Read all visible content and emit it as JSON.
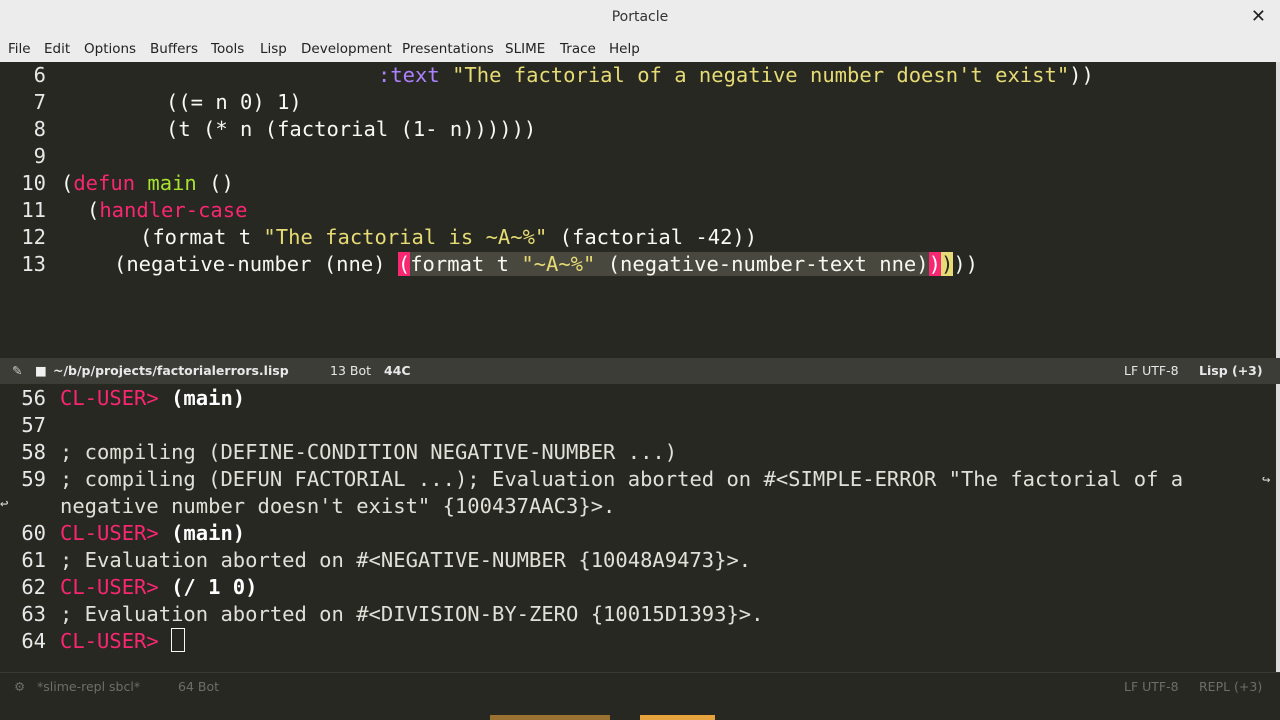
{
  "window": {
    "title": "Portacle"
  },
  "menu": [
    "File",
    "Edit",
    "Options",
    "Buffers",
    "Tools",
    "Lisp",
    "Development",
    "Presentations",
    "SLIME",
    "Trace",
    "Help"
  ],
  "editor": {
    "lines": [
      {
        "num": "6",
        "parts": [
          {
            "t": ":text",
            "c": "kwd"
          },
          {
            "t": " ",
            "c": ""
          },
          {
            "t": "\"The factorial of a negative number doesn't exist\"",
            "c": "str"
          },
          {
            "t": "))",
            "c": ""
          }
        ]
      },
      {
        "num": "7",
        "parts": [
          {
            "t": "((= n 0) 1)",
            "c": ""
          }
        ]
      },
      {
        "num": "8",
        "parts": [
          {
            "t": "(t (* n (factorial (1- n))))))",
            "c": ""
          }
        ]
      },
      {
        "num": "9",
        "parts": []
      },
      {
        "num": "10",
        "parts": [
          {
            "t": "(",
            "c": ""
          },
          {
            "t": "defun",
            "c": "kw"
          },
          {
            "t": " ",
            "c": ""
          },
          {
            "t": "main",
            "c": "fn"
          },
          {
            "t": " ()",
            "c": ""
          }
        ]
      },
      {
        "num": "11",
        "parts": [
          {
            "t": "(",
            "c": ""
          },
          {
            "t": "handler-case",
            "c": "kw"
          }
        ]
      },
      {
        "num": "12",
        "parts": [
          {
            "t": "(format t ",
            "c": ""
          },
          {
            "t": "\"The factorial is ~A~%\"",
            "c": "str"
          },
          {
            "t": " (factorial -42))",
            "c": ""
          }
        ]
      },
      {
        "num": "13",
        "parts": [
          {
            "t": "(negative-number (nne) ",
            "c": ""
          },
          {
            "t": "(",
            "c": "parenhl"
          },
          {
            "t": "format t ",
            "c": "region"
          },
          {
            "t": "\"~A~%\"",
            "c": "region str"
          },
          {
            "t": " (negative-number-text nne)",
            "c": "region"
          },
          {
            "t": ")",
            "c": "parenhl"
          },
          {
            "t": ")",
            "c": "parenmatch"
          },
          {
            "t": "))",
            "c": ""
          }
        ]
      }
    ]
  },
  "modeline": {
    "path": "~/b/p/projects/factorialerrors.lisp",
    "position": "13 Bot",
    "column": "44C",
    "encoding": "LF UTF-8",
    "mode": "Lisp (+3)"
  },
  "repl": {
    "lines": [
      {
        "num": "56",
        "prompt": "CL-USER>",
        "cmd": "(main)"
      },
      {
        "num": "57"
      },
      {
        "num": "58",
        "text": "; compiling (DEFINE-CONDITION NEGATIVE-NUMBER ...)"
      },
      {
        "num": "59",
        "text": "; compiling (DEFUN FACTORIAL ...); Evaluation aborted on #<SIMPLE-ERROR \"The factorial of a"
      },
      {
        "num": "",
        "text": "negative number doesn't exist\" {100437AAC3}>."
      },
      {
        "num": "60",
        "prompt": "CL-USER>",
        "cmd": "(main)"
      },
      {
        "num": "61",
        "text": "; Evaluation aborted on #<NEGATIVE-NUMBER {10048A9473}>."
      },
      {
        "num": "62",
        "prompt": "CL-USER>",
        "cmd": "(/ 1 0)"
      },
      {
        "num": "63",
        "text": "; Evaluation aborted on #<DIVISION-BY-ZERO {10015D1393}>."
      },
      {
        "num": "64",
        "prompt": "CL-USER>",
        "cmd": ""
      }
    ]
  },
  "modeline2": {
    "buffer": "*slime-repl sbcl*",
    "position": "64 Bot",
    "encoding": "LF UTF-8",
    "mode": "REPL (+3)"
  }
}
